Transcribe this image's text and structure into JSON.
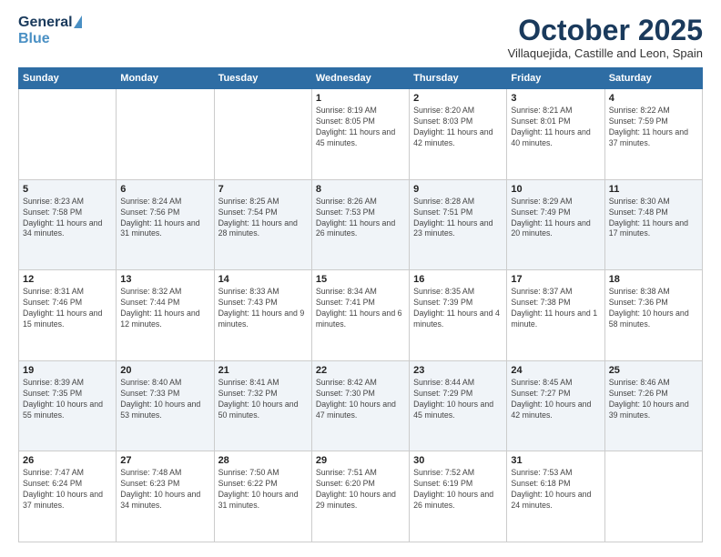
{
  "header": {
    "logo_general": "General",
    "logo_blue": "Blue",
    "month_title": "October 2025",
    "location": "Villaquejida, Castille and Leon, Spain"
  },
  "days_of_week": [
    "Sunday",
    "Monday",
    "Tuesday",
    "Wednesday",
    "Thursday",
    "Friday",
    "Saturday"
  ],
  "weeks": [
    [
      {
        "day": "",
        "info": ""
      },
      {
        "day": "",
        "info": ""
      },
      {
        "day": "",
        "info": ""
      },
      {
        "day": "1",
        "info": "Sunrise: 8:19 AM\nSunset: 8:05 PM\nDaylight: 11 hours\nand 45 minutes."
      },
      {
        "day": "2",
        "info": "Sunrise: 8:20 AM\nSunset: 8:03 PM\nDaylight: 11 hours\nand 42 minutes."
      },
      {
        "day": "3",
        "info": "Sunrise: 8:21 AM\nSunset: 8:01 PM\nDaylight: 11 hours\nand 40 minutes."
      },
      {
        "day": "4",
        "info": "Sunrise: 8:22 AM\nSunset: 7:59 PM\nDaylight: 11 hours\nand 37 minutes."
      }
    ],
    [
      {
        "day": "5",
        "info": "Sunrise: 8:23 AM\nSunset: 7:58 PM\nDaylight: 11 hours\nand 34 minutes."
      },
      {
        "day": "6",
        "info": "Sunrise: 8:24 AM\nSunset: 7:56 PM\nDaylight: 11 hours\nand 31 minutes."
      },
      {
        "day": "7",
        "info": "Sunrise: 8:25 AM\nSunset: 7:54 PM\nDaylight: 11 hours\nand 28 minutes."
      },
      {
        "day": "8",
        "info": "Sunrise: 8:26 AM\nSunset: 7:53 PM\nDaylight: 11 hours\nand 26 minutes."
      },
      {
        "day": "9",
        "info": "Sunrise: 8:28 AM\nSunset: 7:51 PM\nDaylight: 11 hours\nand 23 minutes."
      },
      {
        "day": "10",
        "info": "Sunrise: 8:29 AM\nSunset: 7:49 PM\nDaylight: 11 hours\nand 20 minutes."
      },
      {
        "day": "11",
        "info": "Sunrise: 8:30 AM\nSunset: 7:48 PM\nDaylight: 11 hours\nand 17 minutes."
      }
    ],
    [
      {
        "day": "12",
        "info": "Sunrise: 8:31 AM\nSunset: 7:46 PM\nDaylight: 11 hours\nand 15 minutes."
      },
      {
        "day": "13",
        "info": "Sunrise: 8:32 AM\nSunset: 7:44 PM\nDaylight: 11 hours\nand 12 minutes."
      },
      {
        "day": "14",
        "info": "Sunrise: 8:33 AM\nSunset: 7:43 PM\nDaylight: 11 hours\nand 9 minutes."
      },
      {
        "day": "15",
        "info": "Sunrise: 8:34 AM\nSunset: 7:41 PM\nDaylight: 11 hours\nand 6 minutes."
      },
      {
        "day": "16",
        "info": "Sunrise: 8:35 AM\nSunset: 7:39 PM\nDaylight: 11 hours\nand 4 minutes."
      },
      {
        "day": "17",
        "info": "Sunrise: 8:37 AM\nSunset: 7:38 PM\nDaylight: 11 hours\nand 1 minute."
      },
      {
        "day": "18",
        "info": "Sunrise: 8:38 AM\nSunset: 7:36 PM\nDaylight: 10 hours\nand 58 minutes."
      }
    ],
    [
      {
        "day": "19",
        "info": "Sunrise: 8:39 AM\nSunset: 7:35 PM\nDaylight: 10 hours\nand 55 minutes."
      },
      {
        "day": "20",
        "info": "Sunrise: 8:40 AM\nSunset: 7:33 PM\nDaylight: 10 hours\nand 53 minutes."
      },
      {
        "day": "21",
        "info": "Sunrise: 8:41 AM\nSunset: 7:32 PM\nDaylight: 10 hours\nand 50 minutes."
      },
      {
        "day": "22",
        "info": "Sunrise: 8:42 AM\nSunset: 7:30 PM\nDaylight: 10 hours\nand 47 minutes."
      },
      {
        "day": "23",
        "info": "Sunrise: 8:44 AM\nSunset: 7:29 PM\nDaylight: 10 hours\nand 45 minutes."
      },
      {
        "day": "24",
        "info": "Sunrise: 8:45 AM\nSunset: 7:27 PM\nDaylight: 10 hours\nand 42 minutes."
      },
      {
        "day": "25",
        "info": "Sunrise: 8:46 AM\nSunset: 7:26 PM\nDaylight: 10 hours\nand 39 minutes."
      }
    ],
    [
      {
        "day": "26",
        "info": "Sunrise: 7:47 AM\nSunset: 6:24 PM\nDaylight: 10 hours\nand 37 minutes."
      },
      {
        "day": "27",
        "info": "Sunrise: 7:48 AM\nSunset: 6:23 PM\nDaylight: 10 hours\nand 34 minutes."
      },
      {
        "day": "28",
        "info": "Sunrise: 7:50 AM\nSunset: 6:22 PM\nDaylight: 10 hours\nand 31 minutes."
      },
      {
        "day": "29",
        "info": "Sunrise: 7:51 AM\nSunset: 6:20 PM\nDaylight: 10 hours\nand 29 minutes."
      },
      {
        "day": "30",
        "info": "Sunrise: 7:52 AM\nSunset: 6:19 PM\nDaylight: 10 hours\nand 26 minutes."
      },
      {
        "day": "31",
        "info": "Sunrise: 7:53 AM\nSunset: 6:18 PM\nDaylight: 10 hours\nand 24 minutes."
      },
      {
        "day": "",
        "info": ""
      }
    ]
  ]
}
